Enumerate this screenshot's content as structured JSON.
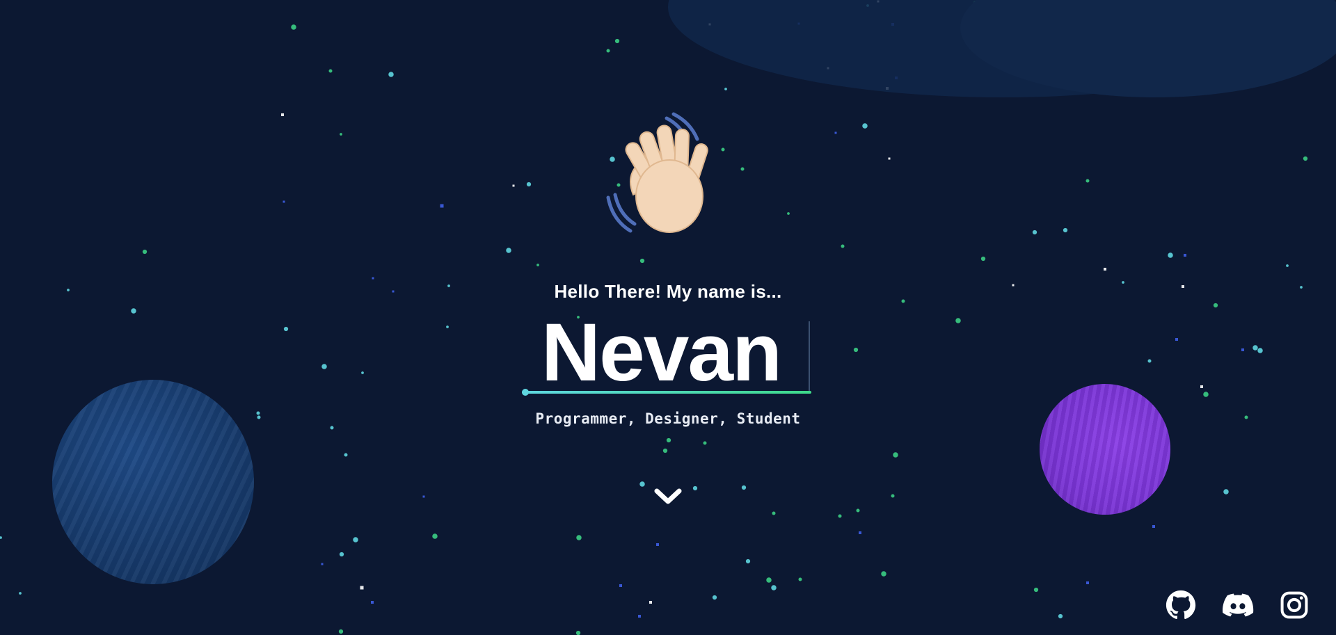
{
  "hero": {
    "greeting": "Hello There! My name is...",
    "name": "Nevan",
    "roles": "Programmer, Designer, Student"
  },
  "icons": {
    "wave": "waving-hand-icon",
    "scroll": "chevron-down-icon",
    "social": [
      "github-icon",
      "discord-icon",
      "instagram-icon"
    ]
  },
  "colors": {
    "background": "#0c1832",
    "underline_start": "#5fd6e0",
    "underline_end": "#3ed98a",
    "planet_blue": "#1a4580",
    "planet_purple": "#7e38dc",
    "star_cyan": "#5fd6e0",
    "star_green": "#3ed98a",
    "star_blue": "#3e5ee6"
  }
}
